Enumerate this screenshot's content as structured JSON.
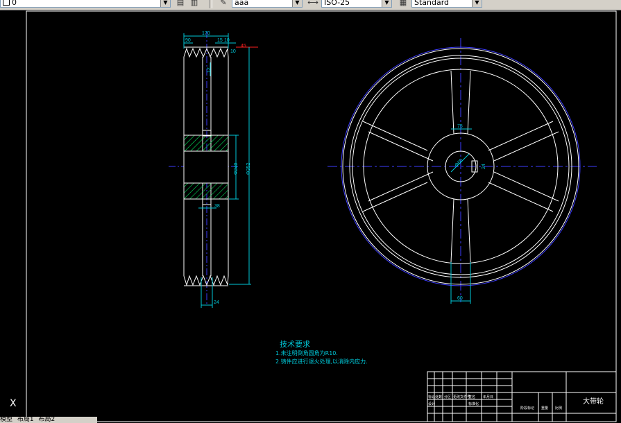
{
  "toolbar": {
    "layer_value": "0",
    "text_style": "aaa",
    "dim_style": "ISO-25",
    "table_style": "Standard"
  },
  "drawing": {
    "side_view": {
      "top_width": "170",
      "dim_left_top": "90",
      "dim_right_a": "15",
      "dim_right_b": "10",
      "dim_right_c": "10",
      "dim_far_right": "45",
      "dim_small": "12",
      "hub_diameter": "Φ240",
      "outer_diameter": "Φ352",
      "hub_width": "38",
      "web_width": "24"
    },
    "front_view": {
      "hub_dim": "75",
      "bore_dim": "Φ60",
      "keyway_dim": "24",
      "spoke_dim": "60"
    },
    "notes": {
      "title": "技术要求",
      "line1": "1.未注明倒角圆角为R10.",
      "line2": "2.铸件应进行退火处理,以消除内应力."
    },
    "title_block": {
      "part_name": "大带轮",
      "row1": [
        "标记",
        "处数",
        "分区",
        "更改文件号",
        "签名",
        "年月日"
      ],
      "row2": [
        "设计",
        "",
        "",
        "标准化",
        "",
        ""
      ],
      "row3_right": [
        "阶段标记",
        "重量",
        "比例"
      ]
    }
  },
  "status": {
    "ucs_label": "X",
    "tabs": [
      "模型",
      "布局1",
      "布局2"
    ]
  },
  "colors": {
    "draw_white": "#ffffff",
    "dim_cyan": "#00c8d8",
    "center_blue": "#3c3cff",
    "hatch_green": "#00ff66",
    "red": "#ff2020"
  }
}
